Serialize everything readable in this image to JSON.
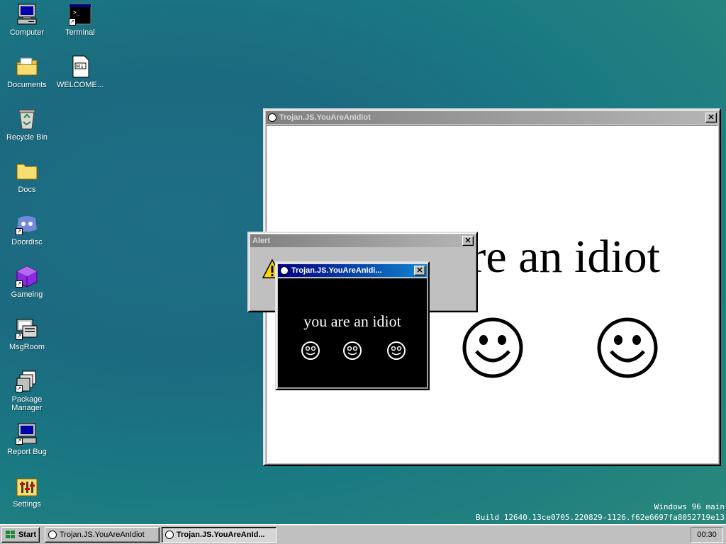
{
  "desktop": {
    "icons": [
      {
        "label": "Computer",
        "icon": "computer-icon"
      },
      {
        "label": "Terminal",
        "icon": "terminal-icon"
      },
      {
        "label": "Documents",
        "icon": "documents-folder-icon"
      },
      {
        "label": "WELCOME...",
        "icon": "markdown-file-icon"
      },
      {
        "label": "Recycle Bin",
        "icon": "recycle-bin-icon"
      },
      {
        "label": "Docs",
        "icon": "folder-icon"
      },
      {
        "label": "Doordisc",
        "icon": "doordisc-icon"
      },
      {
        "label": "Gameing",
        "icon": "game-cube-icon"
      },
      {
        "label": "MsgRoom",
        "icon": "msgroom-icon"
      },
      {
        "label": "Package Manager",
        "icon": "package-manager-icon"
      },
      {
        "label": "Report Bug",
        "icon": "report-bug-icon"
      },
      {
        "label": "Settings",
        "icon": "settings-icon"
      }
    ],
    "watermark": {
      "line1": "Windows 96 main",
      "line2": "Build 12640.13ce0705.220829-1126.f62e6697fa8052719e13"
    }
  },
  "windows": {
    "big": {
      "title": "Trojan.JS.YouAreAnIdiot",
      "text": "you are an idiot",
      "bg": "#ffffff"
    },
    "alert": {
      "title": "Alert"
    },
    "small": {
      "title": "Trojan.JS.YouAreAnIdi...",
      "text": "you are an idiot",
      "bg": "#000000"
    }
  },
  "taskbar": {
    "start_label": "Start",
    "tasks": [
      {
        "label": "Trojan.JS.YouAreAnIdiot",
        "active": false
      },
      {
        "label": "Trojan.JS.YouAreAnId...",
        "active": true
      }
    ],
    "clock": "00:30"
  },
  "colors": {
    "active_title": "#000080",
    "inactive_title": "#808080",
    "desktop": "#1b6a80"
  }
}
